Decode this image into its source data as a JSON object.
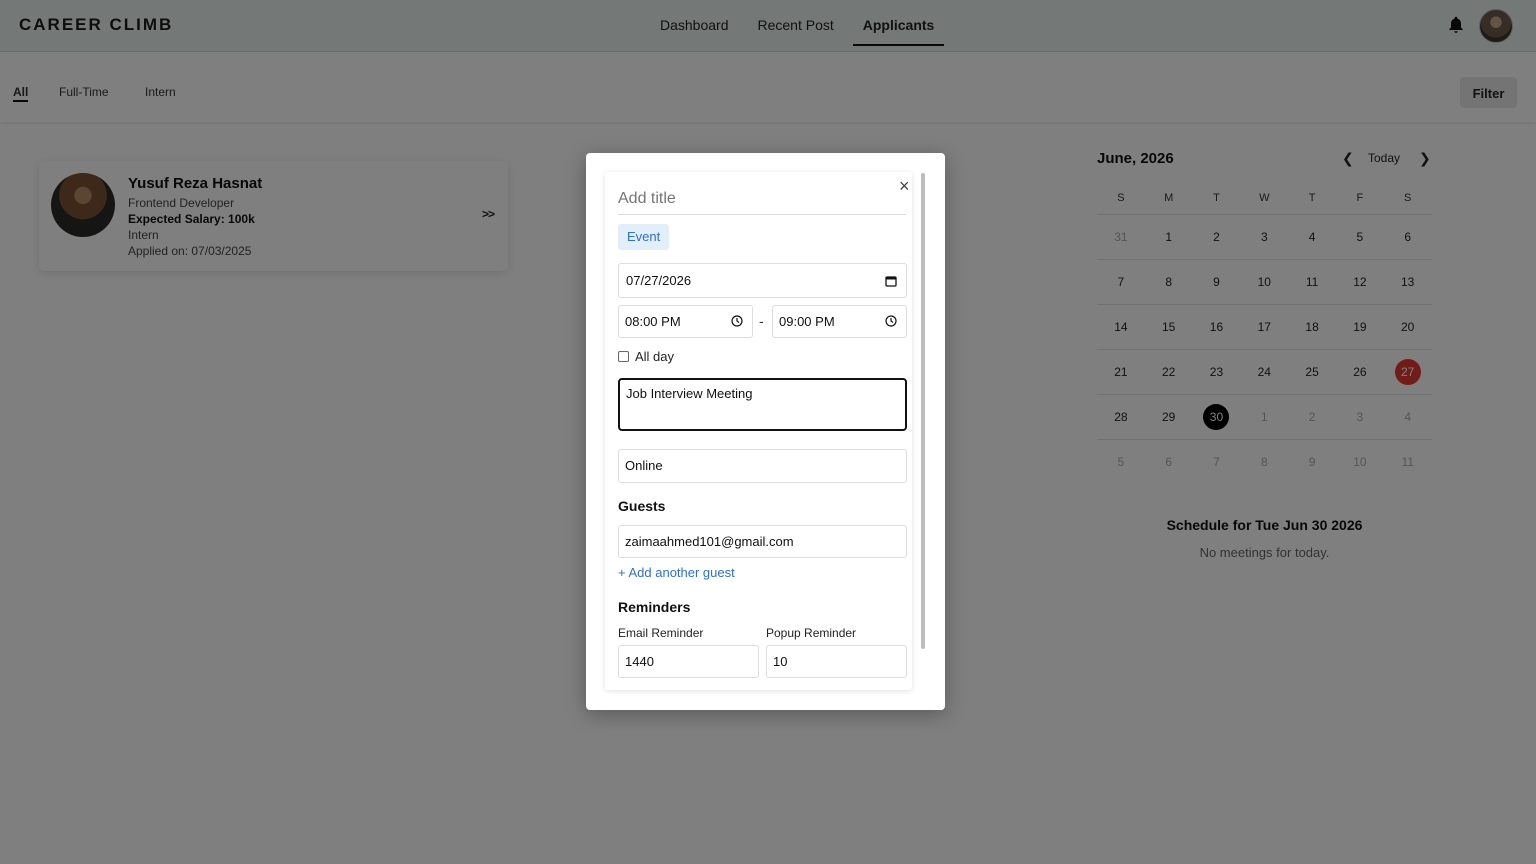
{
  "header": {
    "logo": "CAREER CLIMB",
    "nav": [
      "Dashboard",
      "Recent Post",
      "Applicants"
    ],
    "active_nav": "Applicants"
  },
  "tabs": {
    "items": [
      "All",
      "Full-Time",
      "Intern"
    ],
    "filter_label": "Filter"
  },
  "applicant": {
    "name": "Yusuf Reza Hasnat",
    "role": "Frontend Developer",
    "salary": "Expected Salary: 100k",
    "type": "Intern",
    "applied": "Applied on: 07/03/2025",
    "arrow": ">>"
  },
  "calendar": {
    "title": "June, 2026",
    "today_label": "Today",
    "weekdays": [
      "S",
      "M",
      "T",
      "W",
      "T",
      "F",
      "S"
    ],
    "weeks": [
      [
        "31",
        "1",
        "2",
        "3",
        "4",
        "5",
        "6"
      ],
      [
        "7",
        "8",
        "9",
        "10",
        "11",
        "12",
        "13"
      ],
      [
        "14",
        "15",
        "16",
        "17",
        "18",
        "19",
        "20"
      ],
      [
        "21",
        "22",
        "23",
        "24",
        "25",
        "26",
        "27"
      ],
      [
        "28",
        "29",
        "30",
        "1",
        "2",
        "3",
        "4"
      ],
      [
        "5",
        "6",
        "7",
        "8",
        "9",
        "10",
        "11"
      ]
    ],
    "today_day": "27",
    "selected_day": "30",
    "schedule_title": "Schedule for Tue Jun 30 2026",
    "schedule_empty": "No meetings for today.",
    "colors": {
      "today": "#e53935",
      "selected": "#000000"
    }
  },
  "modal": {
    "title_placeholder": "Add title",
    "event_chip": "Event",
    "date": "07/27/2026",
    "start_time": "08:00 PM",
    "end_time": "09:00 PM",
    "time_separator": "-",
    "allday_label": "All day",
    "description": "Job Interview Meeting",
    "location": "Online",
    "guests_heading": "Guests",
    "guest_email": "zaimaahmed101@gmail.com",
    "add_guest": "+ Add another guest",
    "reminders_heading": "Reminders",
    "email_reminder_label": "Email Reminder",
    "email_reminder_value": "1440",
    "popup_reminder_label": "Popup Reminder",
    "popup_reminder_value": "10",
    "close": "×"
  }
}
